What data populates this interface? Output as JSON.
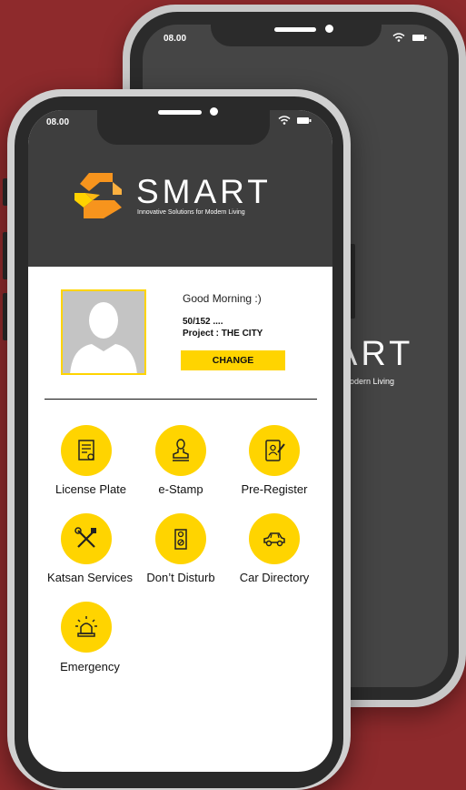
{
  "status": {
    "time_front": "08.00",
    "time_back": "08.00"
  },
  "brand": {
    "name": "SMART",
    "tagline": "Innovative Solutions for Modern Living",
    "back_name": "ART",
    "back_tagline": "r Modern Living"
  },
  "profile": {
    "greeting": "Good Morning :)",
    "unit": "50/152 ....",
    "project": "Project : THE CITY",
    "change_label": "CHANGE"
  },
  "menu": [
    {
      "label": "License Plate",
      "icon": "license-plate-icon"
    },
    {
      "label": "e-Stamp",
      "icon": "stamp-icon"
    },
    {
      "label": "Pre-Register",
      "icon": "pre-register-icon"
    },
    {
      "label": "Katsan Services",
      "icon": "tools-icon"
    },
    {
      "label": "Don’t Disturb",
      "icon": "door-hanger-icon"
    },
    {
      "label": "Car Directory",
      "icon": "car-icon"
    },
    {
      "label": "Emergency",
      "icon": "siren-icon"
    }
  ],
  "colors": {
    "accent": "#ffd400",
    "background": "#8e2a2c",
    "header": "#3e3e3e",
    "logo_orange": "#f7941d"
  }
}
